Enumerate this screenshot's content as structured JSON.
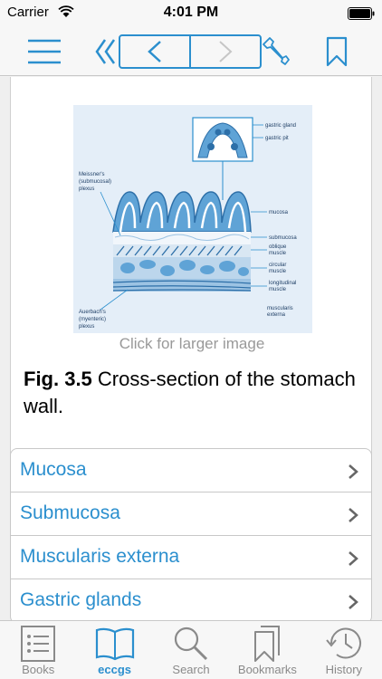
{
  "status": {
    "carrier": "Carrier",
    "time": "4:01 PM"
  },
  "figure": {
    "caption_hint": "Click for larger image",
    "fig_num": "Fig. 3.5",
    "caption": " Cross-section of the stomach wall.",
    "labels": {
      "gastric_gland": "gastric gland",
      "gastric_pit": "gastric pit",
      "meissner": [
        "Meissner's",
        "(submucosal)",
        "plexus"
      ],
      "mucosa": "mucosa",
      "submucosa": "submucosa",
      "oblique": [
        "oblique",
        "muscle"
      ],
      "circular": [
        "circular",
        "muscle"
      ],
      "longitudinal": [
        "longitudinal",
        "muscle"
      ],
      "auerbach": [
        "Auerbach's",
        "(myenteric)",
        "plexus"
      ],
      "muscularis": [
        "muscularis",
        "externa"
      ]
    }
  },
  "links": [
    {
      "label": "Mucosa"
    },
    {
      "label": "Submucosa"
    },
    {
      "label": "Muscularis externa"
    },
    {
      "label": "Gastric glands"
    }
  ],
  "tabs": [
    {
      "label": "Books",
      "icon": "list-icon"
    },
    {
      "label": "eccgs",
      "icon": "book-icon",
      "active": true
    },
    {
      "label": "Search",
      "icon": "magnifier-icon"
    },
    {
      "label": "Bookmarks",
      "icon": "bookmarks-icon"
    },
    {
      "label": "History",
      "icon": "clock-icon"
    }
  ],
  "colors": {
    "accent": "#2b8fce",
    "tissue": "#5fa3d6",
    "tissue_dark": "#2d6fa8"
  }
}
